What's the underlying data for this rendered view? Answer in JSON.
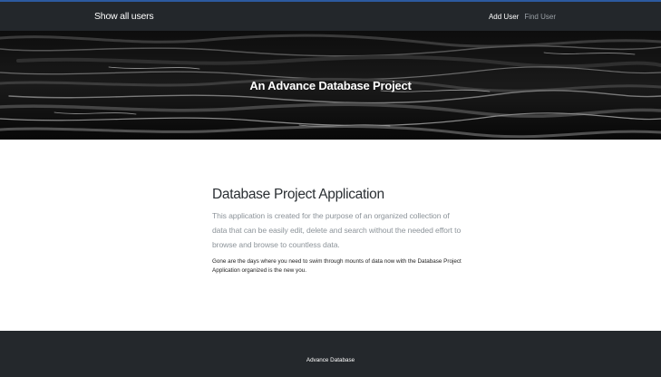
{
  "nav": {
    "brand": "Show all users",
    "links": [
      "Add User",
      "Find User"
    ]
  },
  "hero": {
    "title": "An Advance Database Project"
  },
  "main": {
    "heading": "Database Project Application",
    "lead": "This application is created for the purpose of an organized collection of data that can be easily edit, delete and search without the needed effort to browse and browse to countless data.",
    "body": "Gone are the days where you need to swim through mounts of data now with the Database Project Application organized is the new you."
  },
  "footer": {
    "text": "Advance Database"
  },
  "colors": {
    "navbar": "#23272b",
    "footer": "#24282c",
    "accent_top_border": "#2c5aa0"
  }
}
